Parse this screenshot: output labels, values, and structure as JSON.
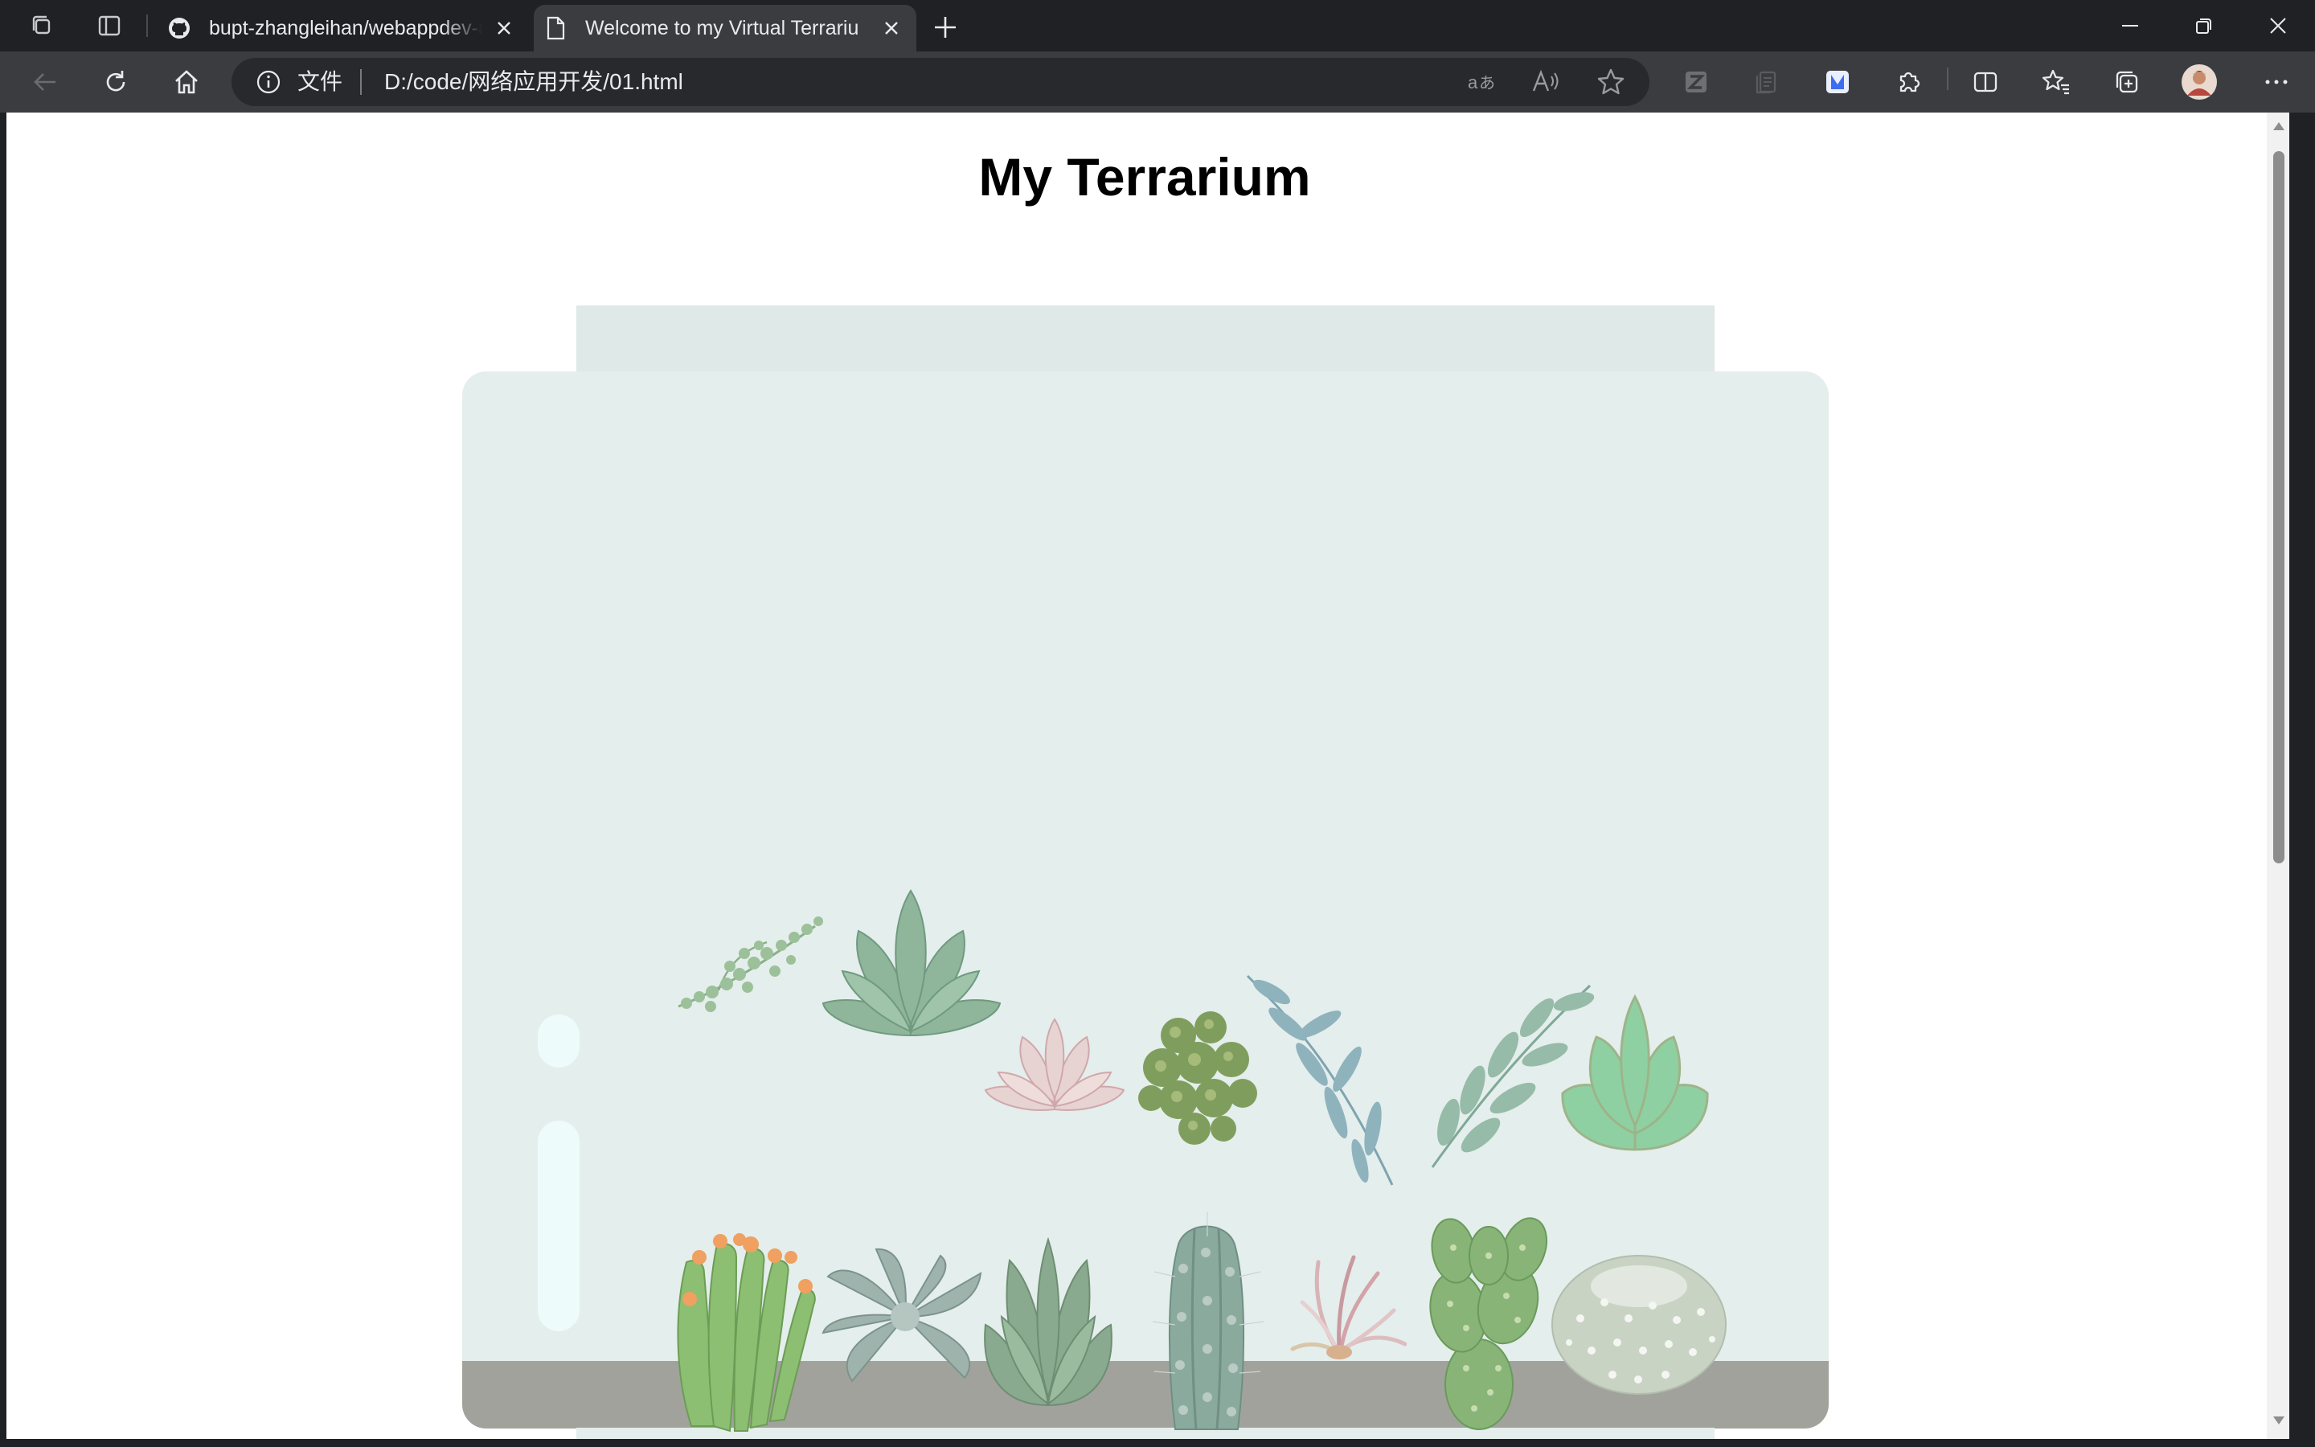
{
  "browser": {
    "tabs": [
      {
        "title": "bupt-zhangleihan/webappdev-as",
        "active": false,
        "icon": "github-icon"
      },
      {
        "title": "Welcome to my Virtual Terrarium",
        "active": true,
        "icon": "page-icon"
      }
    ],
    "address": {
      "protocol_label": "文件",
      "url": "D:/code/网络应用开发/01.html"
    }
  },
  "page": {
    "title": "My Terrarium"
  },
  "terrarium": {
    "colors": {
      "jar_glass": "#e4eeec",
      "jar_top": "#dfe9e7",
      "jar_bottom": "#a2a29d",
      "glint": "#eefbfb"
    },
    "plants_row1": [
      "trailing-plant",
      "echeveria-green",
      "echeveria-pink",
      "moss-plant",
      "eucalyptus-branch",
      "leafy-branch",
      "jade-succulent"
    ],
    "plants_row2": [
      "flowering-cactus",
      "grey-succulent",
      "aloe-succulent",
      "column-cactus",
      "air-plant",
      "prickly-pear-cactus",
      "round-cactus"
    ]
  }
}
